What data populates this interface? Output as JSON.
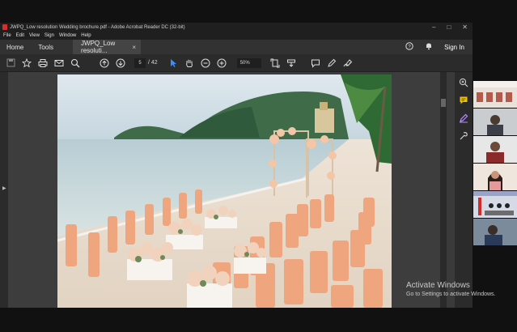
{
  "window": {
    "title": "JWPQ_Low resolution Wedding brochure.pdf - Adobe Acrobat Reader DC (32-bit)",
    "controls": [
      "–",
      "□",
      "✕"
    ]
  },
  "menu": [
    "File",
    "Edit",
    "View",
    "Sign",
    "Window",
    "Help"
  ],
  "tabs": {
    "home": "Home",
    "tools": "Tools",
    "document": "JWPQ_Low resoluti...",
    "close": "×",
    "sign_in": "Sign In"
  },
  "toolbar": {
    "page_current": "5",
    "page_total": "/ 42",
    "zoom": "50%"
  },
  "activate": {
    "title": "Activate Windows",
    "subtitle": "Go to Settings to activate Windows."
  },
  "colors": {
    "accent_yellow": "#f2c200",
    "accent_purple": "#b58cff",
    "acrobat_red": "#d32f2f"
  },
  "icons": {
    "right_panel": [
      "zoom-icon",
      "comment-icon",
      "fill-sign-icon",
      "more-tools-icon"
    ]
  }
}
